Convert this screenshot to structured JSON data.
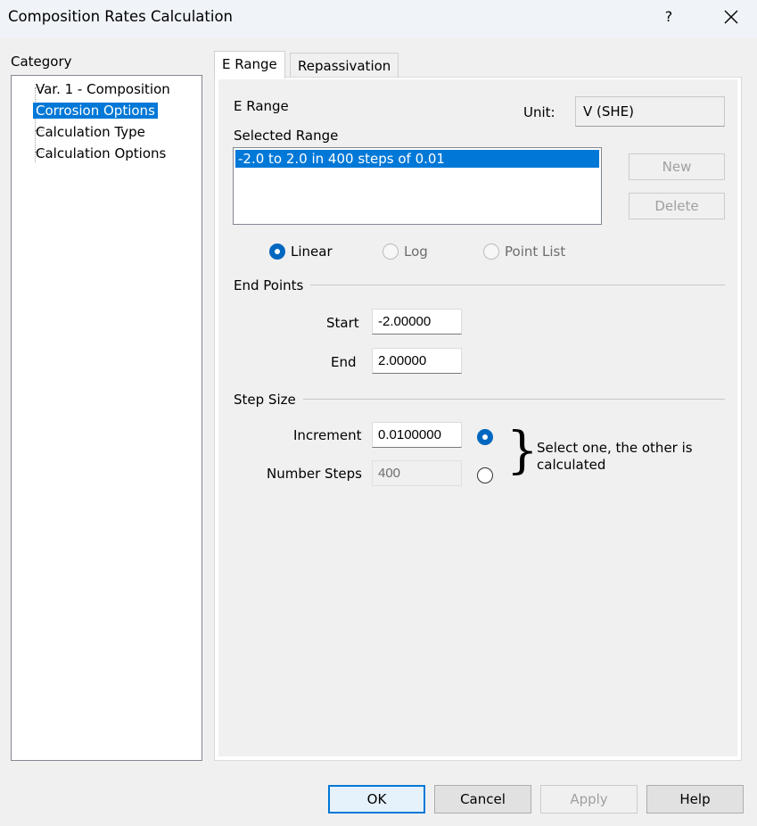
{
  "window": {
    "title": "Composition Rates Calculation",
    "help_label": "?"
  },
  "category": {
    "label": "Category",
    "items": [
      {
        "label": "Var. 1 - Composition",
        "selected": false
      },
      {
        "label": "Corrosion Options",
        "selected": true
      },
      {
        "label": "Calculation Type",
        "selected": false
      },
      {
        "label": "Calculation Options",
        "selected": false
      }
    ]
  },
  "tabs": [
    {
      "label": "E Range",
      "active": true
    },
    {
      "label": "Repassivation",
      "active": false
    }
  ],
  "erange": {
    "heading": "E Range",
    "unit_label": "Unit:",
    "unit_value": "V (SHE)",
    "selected_range_label": "Selected Range",
    "ranges": [
      "-2.0 to 2.0 in 400 steps of 0.01"
    ],
    "new_button": "New",
    "delete_button": "Delete",
    "scale_options": [
      {
        "label": "Linear",
        "checked": true,
        "enabled": true
      },
      {
        "label": "Log",
        "checked": false,
        "enabled": false
      },
      {
        "label": "Point List",
        "checked": false,
        "enabled": false
      }
    ]
  },
  "end_points": {
    "group_label": "End Points",
    "start_label": "Start",
    "start_value": "-2.00000",
    "end_label": "End",
    "end_value": "2.00000"
  },
  "step_size": {
    "group_label": "Step Size",
    "increment_label": "Increment",
    "increment_value": "0.0100000",
    "increment_selected": true,
    "number_steps_label": "Number Steps",
    "number_steps_value": "400",
    "number_steps_selected": false,
    "brace_glyph": "}",
    "note": "Select one, the other is calculated"
  },
  "footer": {
    "ok": "OK",
    "cancel": "Cancel",
    "apply": "Apply",
    "help": "Help"
  },
  "colors": {
    "selection": "#0078d7",
    "radio_on": "#0067c0",
    "window_bg": "#f0f0f0",
    "titlebar_bg": "#f0f4f9"
  }
}
